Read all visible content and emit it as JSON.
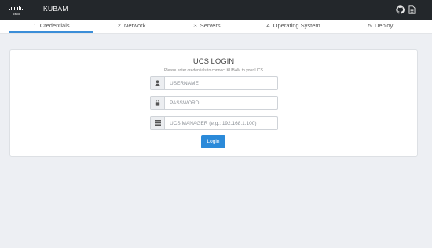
{
  "navbar": {
    "logo_text": "cisco",
    "app_title": "KUBAM",
    "icons": [
      "github-icon",
      "document-icon"
    ]
  },
  "steps": [
    {
      "label": "1. Credentials",
      "active": true
    },
    {
      "label": "2. Network",
      "active": false
    },
    {
      "label": "3. Servers",
      "active": false
    },
    {
      "label": "4. Operating System",
      "active": false
    },
    {
      "label": "5. Deploy",
      "active": false
    }
  ],
  "login": {
    "title": "UCS LOGIN",
    "subtitle": "Please enter credentials to connect KUBAM to your UCS",
    "username_placeholder": "USERNAME",
    "password_placeholder": "PASSWORD",
    "manager_placeholder": "UCS MANAGER (e.g.: 192.168.1.100)",
    "button_label": "Login"
  },
  "colors": {
    "navbar": "#23272b",
    "accent": "#2b8ad9",
    "background": "#edeff3"
  }
}
